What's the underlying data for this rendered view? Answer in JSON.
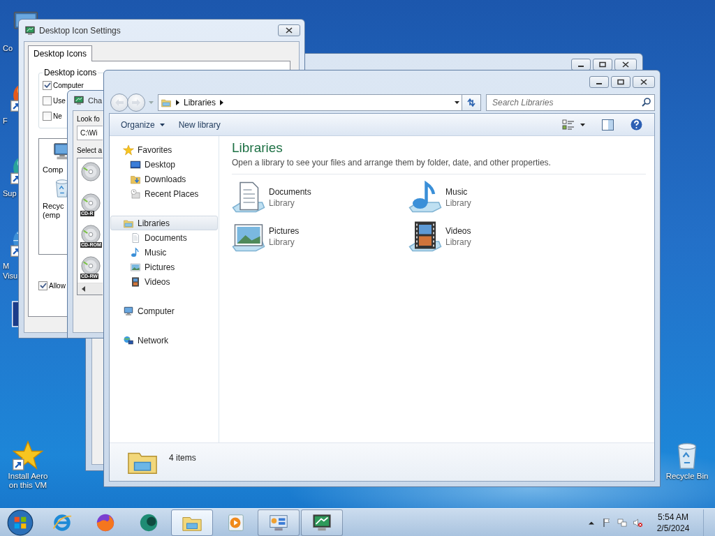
{
  "desktop_icons": [
    {
      "kind": "computer",
      "shortcut": false,
      "label": "Co"
    },
    {
      "kind": "orange-ball",
      "shortcut": true,
      "label": "F"
    },
    {
      "kind": "teal-ball",
      "shortcut": true,
      "label": "Sup"
    },
    {
      "kind": "globe",
      "shortcut": true,
      "label": "M\nVisu"
    },
    {
      "kind": "photo",
      "shortcut": false
    }
  ],
  "corner_icons": [
    {
      "kind": "star",
      "shortcut": true,
      "label": "Install Aero on this VM"
    },
    {
      "kind": "recycle-bin",
      "shortcut": false,
      "label": "Recycle Bin"
    }
  ],
  "icon_settings_dialog": {
    "title": "Desktop Icon Settings",
    "tabs": [
      {
        "label": "Desktop Icons",
        "selected": true
      }
    ],
    "group_title": "Desktop icons",
    "checkboxes": [
      {
        "label": "Computer",
        "checked": true
      },
      {
        "label": "Use",
        "checked": false
      },
      {
        "label": "Ne",
        "checked": false
      }
    ],
    "icons": [
      {
        "kind": "computer",
        "label": "Comp"
      },
      {
        "kind": "recycle-bin",
        "label": "Recyc\n(emp"
      }
    ],
    "allow_checkbox": {
      "label": "Allow",
      "checked": true
    }
  },
  "change_icon_dialog": {
    "title": "Cha",
    "look_for_label": "Look fo",
    "path_field": "C:\\Wi",
    "select_label": "Select a",
    "icons": [
      {
        "kind": "disc"
      },
      {
        "kind": "disc",
        "badge": "CD-R"
      },
      {
        "kind": "disc",
        "badge": "CD-ROM"
      },
      {
        "kind": "disc",
        "badge": "CD-RW"
      }
    ]
  },
  "explorer": {
    "address": {
      "crumbs": [
        "Libraries"
      ]
    },
    "search": {
      "placeholder": "Search Libraries"
    },
    "toolbar": [
      {
        "label": "Organize",
        "dropdown": true
      },
      {
        "label": "New library",
        "dropdown": false
      }
    ],
    "nav": [
      {
        "label": "Favorites",
        "kind": "star",
        "selected": false,
        "children": [
          {
            "label": "Desktop",
            "kind": "desktop",
            "selected": false
          },
          {
            "label": "Downloads",
            "kind": "downloads",
            "selected": false
          },
          {
            "label": "Recent Places",
            "kind": "recent",
            "selected": false
          }
        ]
      },
      {
        "label": "Libraries",
        "kind": "library",
        "selected": true,
        "children": [
          {
            "label": "Documents",
            "kind": "document",
            "selected": false
          },
          {
            "label": "Music",
            "kind": "music",
            "selected": false
          },
          {
            "label": "Pictures",
            "kind": "pictures",
            "selected": false
          },
          {
            "label": "Videos",
            "kind": "videos",
            "selected": false
          }
        ]
      },
      {
        "label": "Computer",
        "kind": "computer",
        "selected": false
      },
      {
        "label": "Network",
        "kind": "network",
        "selected": false
      }
    ],
    "heading": "Libraries",
    "description": "Open a library to see your files and arrange them by folder, date, and other properties.",
    "libraries": [
      {
        "name": "Documents",
        "subtitle": "Library",
        "kind": "document"
      },
      {
        "name": "Music",
        "subtitle": "Library",
        "kind": "music"
      },
      {
        "name": "Pictures",
        "subtitle": "Library",
        "kind": "pictures"
      },
      {
        "name": "Videos",
        "subtitle": "Library",
        "kind": "videos"
      }
    ],
    "status": "4 items"
  },
  "taskbar": {
    "buttons": [
      {
        "kind": "start",
        "running": false,
        "selected": false
      },
      {
        "kind": "ie",
        "running": false,
        "selected": false
      },
      {
        "kind": "firefox",
        "running": false,
        "selected": false
      },
      {
        "kind": "teal-app",
        "running": false,
        "selected": false
      },
      {
        "kind": "explorer",
        "running": true,
        "selected": true
      },
      {
        "kind": "media",
        "running": false,
        "selected": false
      },
      {
        "kind": "control-panel",
        "running": true,
        "selected": false
      },
      {
        "kind": "monitor-app",
        "running": true,
        "selected": false
      }
    ],
    "tray_icons": [
      {
        "kind": "up-arrow"
      },
      {
        "kind": "flag"
      },
      {
        "kind": "network-tray"
      },
      {
        "kind": "speaker-muted"
      }
    ],
    "clock": {
      "time": "5:54 AM",
      "date": "2/5/2024"
    }
  }
}
